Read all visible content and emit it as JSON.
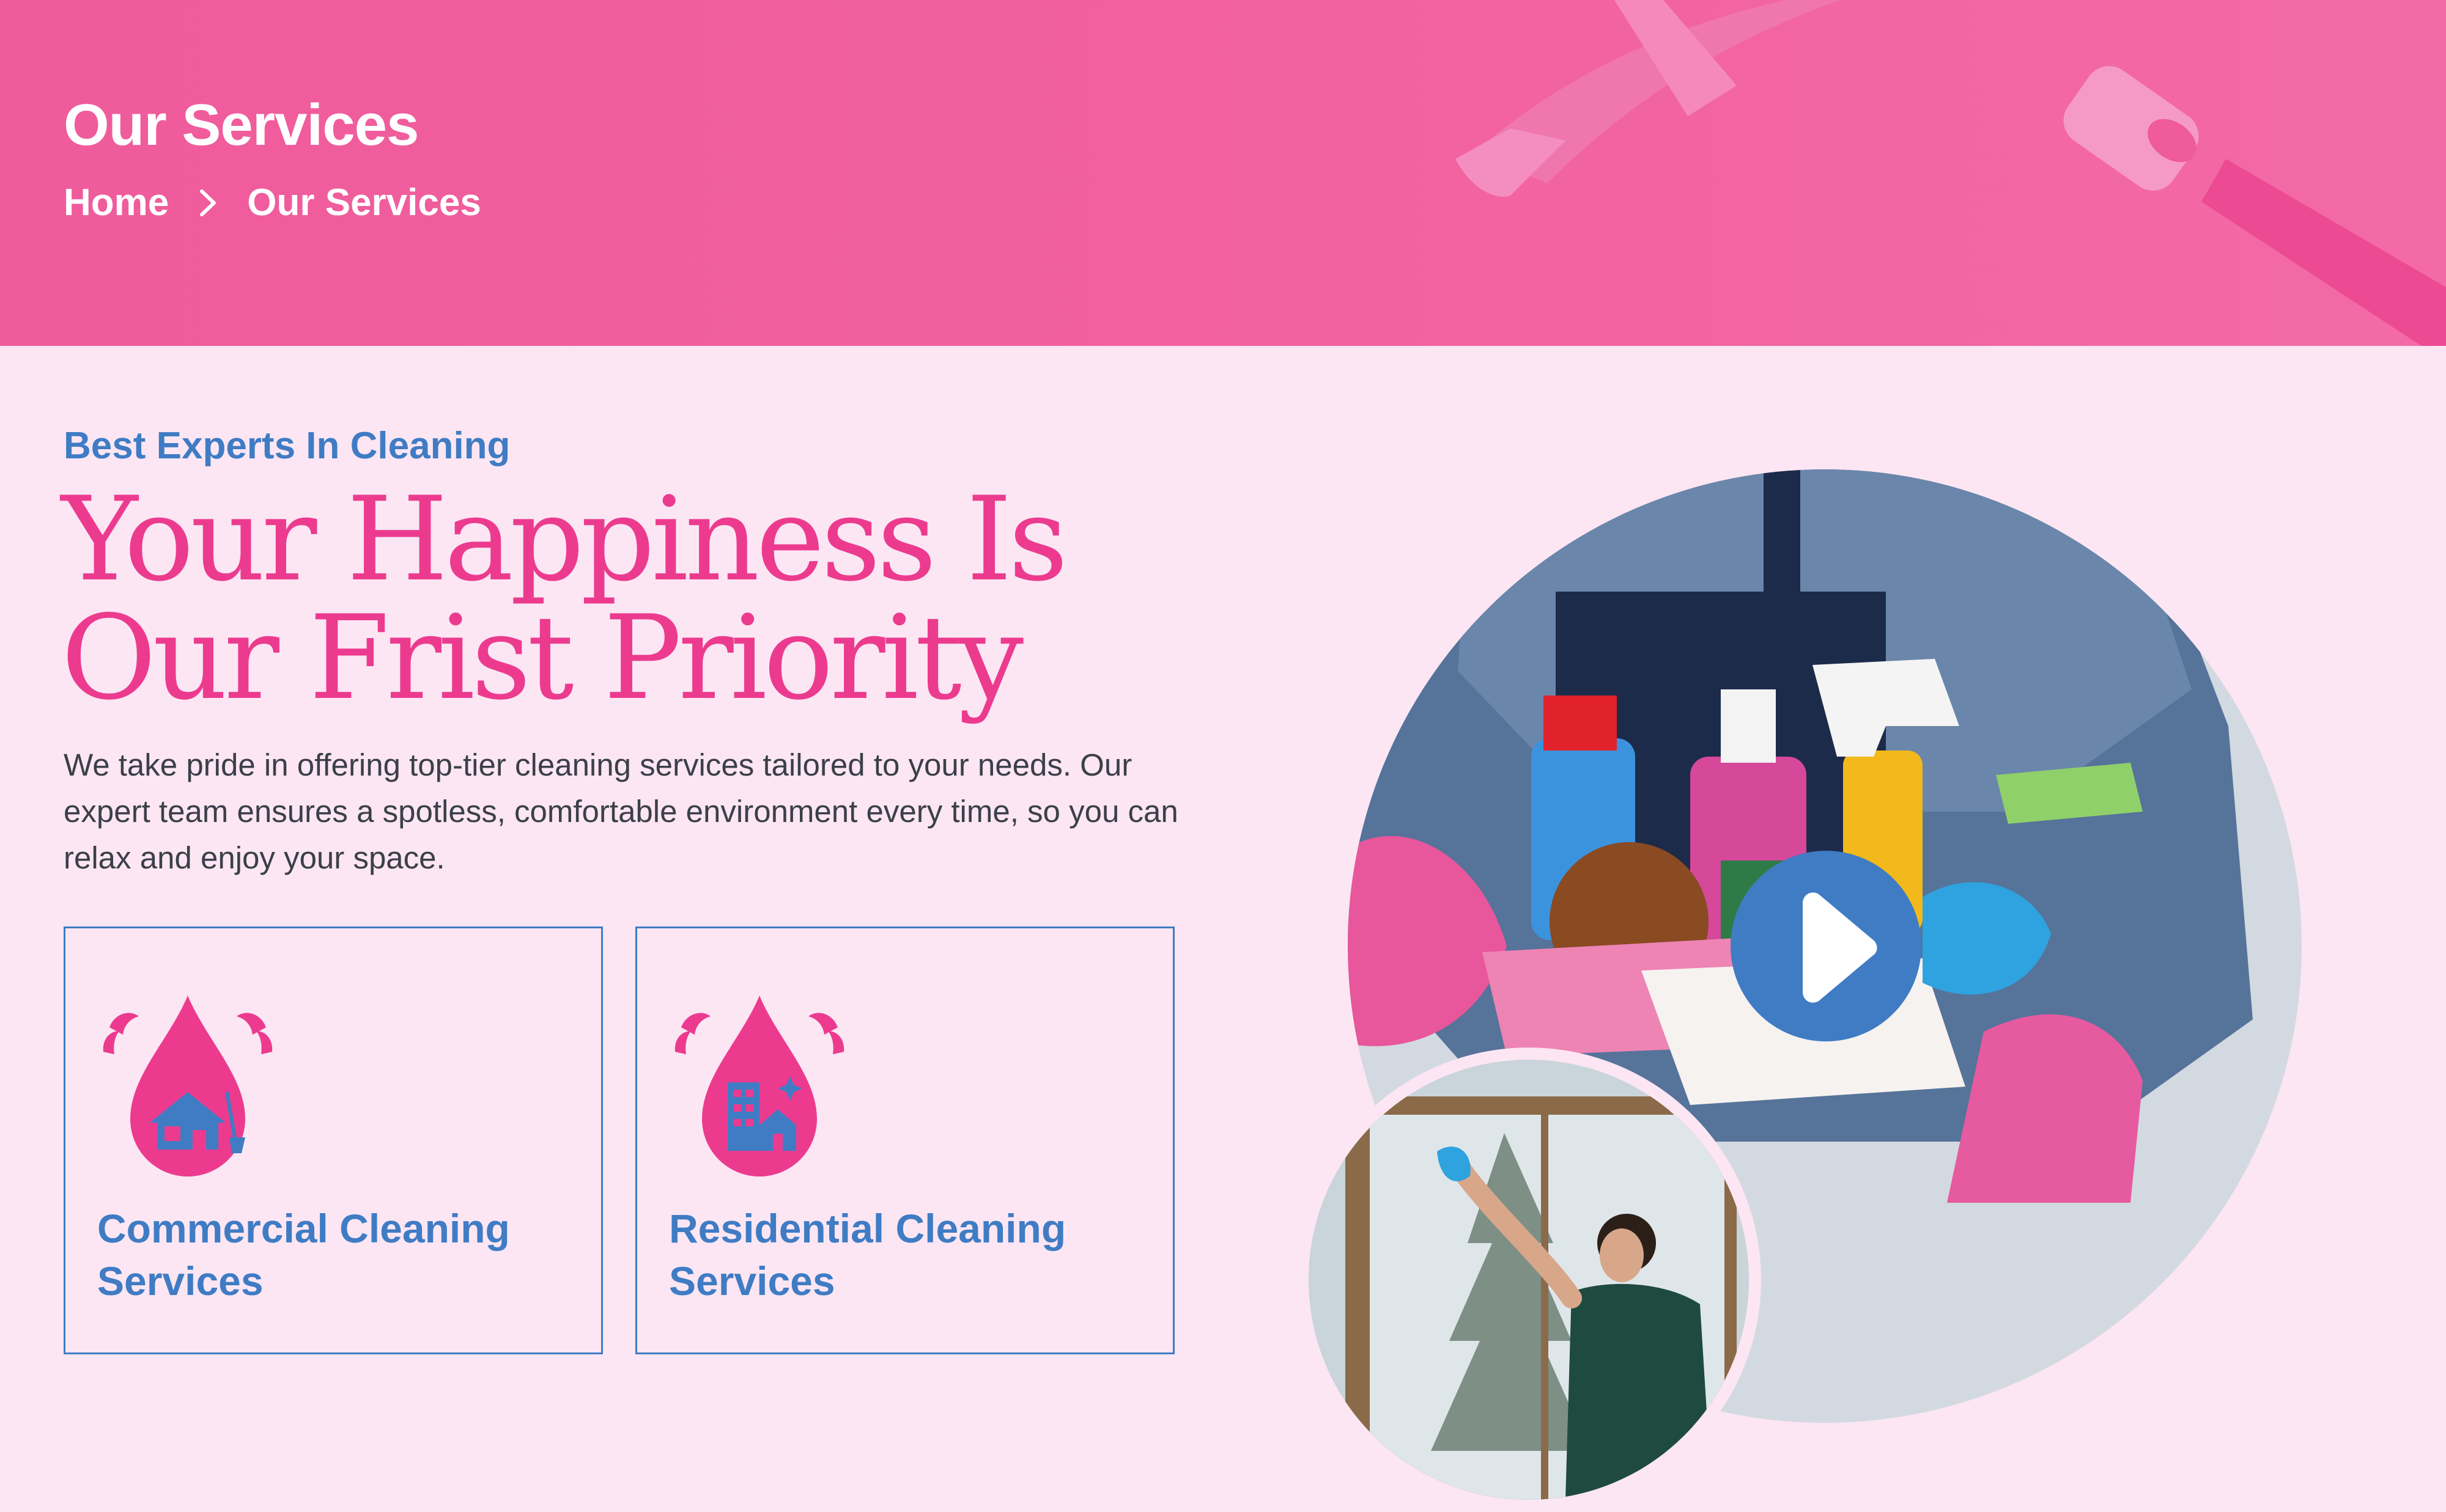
{
  "banner": {
    "title": "Our Services",
    "breadcrumb": {
      "home": "Home",
      "current": "Our Services"
    }
  },
  "intro": {
    "eyebrow": "Best Experts In Cleaning",
    "headline_line1": "Your Happiness Is",
    "headline_line2": "Our Frist Priority",
    "description": "We take pride in offering top-tier cleaning services tailored to your needs. Our expert team ensures a spotless, comfortable environment every time, so you can relax and enjoy your space."
  },
  "services": [
    {
      "title_line1": "Commercial Cleaning",
      "title_line2": "Services",
      "icon": "house-drop-icon"
    },
    {
      "title_line1": "Residential Cleaning",
      "title_line2": "Services",
      "icon": "building-drop-icon"
    }
  ],
  "media": {
    "hero_image": "cleaning-supplies-basket",
    "play_icon": "play-icon",
    "secondary_image": "woman-cleaning-window"
  },
  "colors": {
    "banner_pink": "#f2629f",
    "page_background": "#fce6f3",
    "headline_pink": "#ec3b8f",
    "accent_blue": "#3f7cc4",
    "body_text": "#3b3f4a"
  }
}
